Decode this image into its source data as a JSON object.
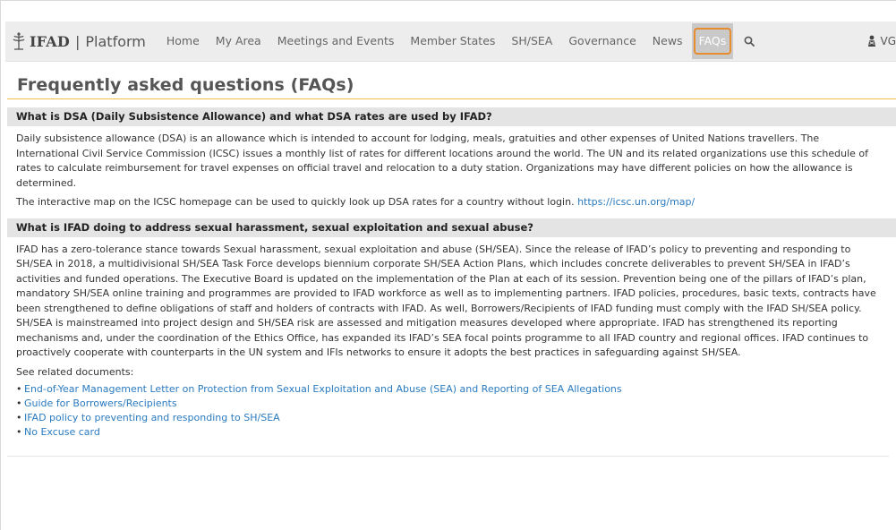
{
  "brand": {
    "name": "IFAD",
    "separator": "|",
    "platform": "Platform"
  },
  "nav": {
    "items": [
      {
        "label": "Home"
      },
      {
        "label": "My Area"
      },
      {
        "label": "Meetings and Events"
      },
      {
        "label": "Member States"
      },
      {
        "label": "SH/SEA"
      },
      {
        "label": "Governance"
      },
      {
        "label": "News"
      },
      {
        "label": "FAQs",
        "active": true
      }
    ],
    "search_icon": "search-icon",
    "user_initials": "VG"
  },
  "page": {
    "title": "Frequently asked questions (FAQs)"
  },
  "faq": [
    {
      "question": "What is DSA (Daily Subsistence Allowance) and what DSA rates are used by IFAD?",
      "paragraphs": [
        "Daily subsistence allowance (DSA) is an allowance which is intended to account for lodging, meals, gratuities and other expenses of United Nations travellers. The International Civil Service Commission (ICSC) issues a monthly list of rates for different locations around the world. The UN and its related organizations use this schedule of rates to calculate reimbursement for travel expenses on official travel and relocation to a duty station. Organizations may have different policies on how the allowance is determined."
      ],
      "map_text": "The interactive map on the ICSC homepage can be used to quickly look up DSA rates for a country without login.",
      "map_link": "https://icsc.un.org/map/"
    },
    {
      "question": "What is IFAD doing to address sexual harassment, sexual exploitation and sexual abuse?",
      "paragraphs": [
        "IFAD has a zero-tolerance stance towards Sexual harassment, sexual exploitation and abuse (SH/SEA). Since the release of IFAD’s policy to preventing and responding to SH/SEA in 2018, a multidivisional SH/SEA Task Force develops biennium corporate SH/SEA Action Plans, which includes concrete deliverables to prevent SH/SEA in IFAD’s activities and funded operations. The Executive Board is updated on the implementation of the Plan at each of its session. Prevention being one of the pillars of IFAD’s plan, mandatory SH/SEA online training and programmes are provided to IFAD workforce as well as to implementing partners. IFAD policies, procedures, basic texts, contracts have been strengthened to define obligations of staff and holders of contracts with IFAD. As well, Borrowers/Recipients of IFAD funding must comply with the IFAD SH/SEA policy. SH/SEA is mainstreamed into project design and SH/SEA risk are assessed and mitigation measures developed where appropriate. IFAD has strengthened its reporting mechanisms and, under the coordination of the Ethics Office, has expanded its IFAD’s SEA focal points programme to all IFAD country and regional offices. IFAD continues to proactively cooperate with counterparts in the UN system and IFIs networks to ensure it adopts the best practices in safeguarding against SH/SEA."
      ],
      "related_label": "See related documents:",
      "bullet": "•",
      "documents": [
        "End-of-Year Management Letter on Protection from Sexual Exploitation and Abuse (SEA) and Reporting of SEA Allegations",
        "Guide for Borrowers/Recipients",
        "IFAD policy to preventing and responding to SH/SEA",
        "No Excuse card"
      ]
    }
  ],
  "colors": {
    "accent": "#f0c24c",
    "active_ring": "#e98c2e",
    "link": "#2a7bc0",
    "nav_bg": "#ededed",
    "question_bg": "#e4e4e4"
  }
}
